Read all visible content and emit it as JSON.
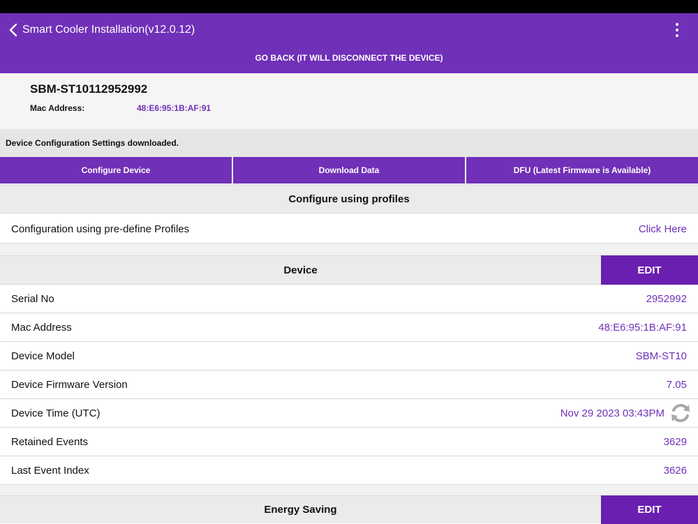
{
  "appbar": {
    "title": "Smart Cooler Installation(v12.0.12)",
    "go_back": "GO BACK (IT WILL DISCONNECT THE DEVICE)"
  },
  "device_header": {
    "name": "SBM-ST10112952992",
    "mac_label": "Mac Address:",
    "mac_value": "48:E6:95:1B:AF:91"
  },
  "status_message": "Device Configuration Settings downloaded.",
  "actions": [
    {
      "label": "Configure Device"
    },
    {
      "label": "Download Data"
    },
    {
      "label": "DFU (Latest Firmware is Available)"
    }
  ],
  "profiles": {
    "header": "Configure using profiles",
    "row_label": "Configuration using pre-define Profiles",
    "row_link": "Click Here"
  },
  "device_section": {
    "header": "Device",
    "edit_label": "EDIT",
    "rows": [
      {
        "label": "Serial No",
        "value": "2952992"
      },
      {
        "label": "Mac Address",
        "value": "48:E6:95:1B:AF:91"
      },
      {
        "label": "Device Model",
        "value": "SBM-ST10"
      },
      {
        "label": "Device Firmware Version",
        "value": "7.05"
      },
      {
        "label": "Device Time (UTC)",
        "value": "Nov 29 2023 03:43PM"
      },
      {
        "label": "Retained Events",
        "value": "3629"
      },
      {
        "label": "Last Event Index",
        "value": "3626"
      }
    ]
  },
  "energy_section": {
    "header": "Energy Saving",
    "edit_label": "EDIT"
  },
  "colors": {
    "accent": "#7030B8",
    "edit_button": "#6A1FB0"
  }
}
